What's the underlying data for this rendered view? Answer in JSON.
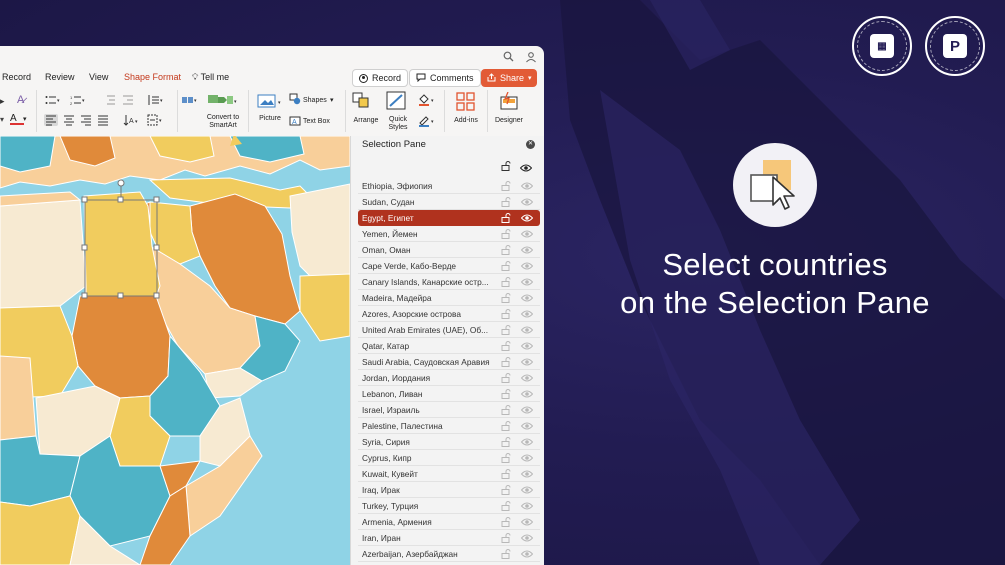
{
  "promo": {
    "headline_line1": "Select countries",
    "headline_line2": "on the Selection Pane",
    "badge_left_icon": "pptx-icon",
    "badge_right_letter": "P",
    "badge_left_text": "PPTYMAN · COM · PPTYMAN · COM",
    "badge_right_text": "EDITABLE · 100 % · POWERPOINT",
    "colors": {
      "background": "#221c52",
      "text": "#ffffff"
    }
  },
  "menu": {
    "items": [
      "Record",
      "Review",
      "View",
      "Shape Format"
    ],
    "tell_me": "Tell me",
    "record_button": "Record",
    "comments_button": "Comments",
    "share_button": "Share",
    "colors": {
      "accent": "#c4391c",
      "share": "#e25b36"
    }
  },
  "ribbon": {
    "convert_label_line1": "Convert to",
    "convert_label_line2": "SmartArt",
    "picture_label": "Picture",
    "shapes_label": "Shapes",
    "textbox_label": "Text Box",
    "arrange_label": "Arrange",
    "quick_styles_line1": "Quick",
    "quick_styles_line2": "Styles",
    "addins_label": "Add-ins",
    "designer_label": "Designer"
  },
  "pane": {
    "title": "Selection Pane",
    "selected_color": "#b0321e",
    "items": [
      {
        "label": "Ethiopia, Эфиопия",
        "selected": false
      },
      {
        "label": "Sudan, Судан",
        "selected": false
      },
      {
        "label": "Egypt, Египет",
        "selected": true
      },
      {
        "label": "Yemen, Йемен",
        "selected": false
      },
      {
        "label": "Oman, Оман",
        "selected": false
      },
      {
        "label": "Cape Verde, Кабо-Верде",
        "selected": false
      },
      {
        "label": "Canary Islands, Канарские остр...",
        "selected": false
      },
      {
        "label": "Madeira, Мадейра",
        "selected": false
      },
      {
        "label": "Azores, Азорские острова",
        "selected": false
      },
      {
        "label": "United Arab Emirates (UAE), Об...",
        "selected": false
      },
      {
        "label": "Qatar, Катар",
        "selected": false
      },
      {
        "label": "Saudi Arabia, Саудовская Аравия",
        "selected": false
      },
      {
        "label": "Jordan, Иордания",
        "selected": false
      },
      {
        "label": "Lebanon, Ливан",
        "selected": false
      },
      {
        "label": "Israel, Израиль",
        "selected": false
      },
      {
        "label": "Palestine, Палестина",
        "selected": false
      },
      {
        "label": "Syria, Сирия",
        "selected": false
      },
      {
        "label": "Cyprus, Кипр",
        "selected": false
      },
      {
        "label": "Kuwait, Кувейт",
        "selected": false
      },
      {
        "label": "Iraq, Ирак",
        "selected": false
      },
      {
        "label": "Turkey, Турция",
        "selected": false
      },
      {
        "label": "Armenia, Армения",
        "selected": false
      },
      {
        "label": "Iran, Иран",
        "selected": false
      },
      {
        "label": "Azerbaijan, Азербайджан",
        "selected": false
      }
    ]
  },
  "map": {
    "colors": {
      "sea": "#8fd3e6",
      "orange": "#e08a3a",
      "yellow": "#f1cc5e",
      "teal": "#4fb3c6",
      "cream": "#f7ead2",
      "peach": "#f8cf9a"
    }
  }
}
